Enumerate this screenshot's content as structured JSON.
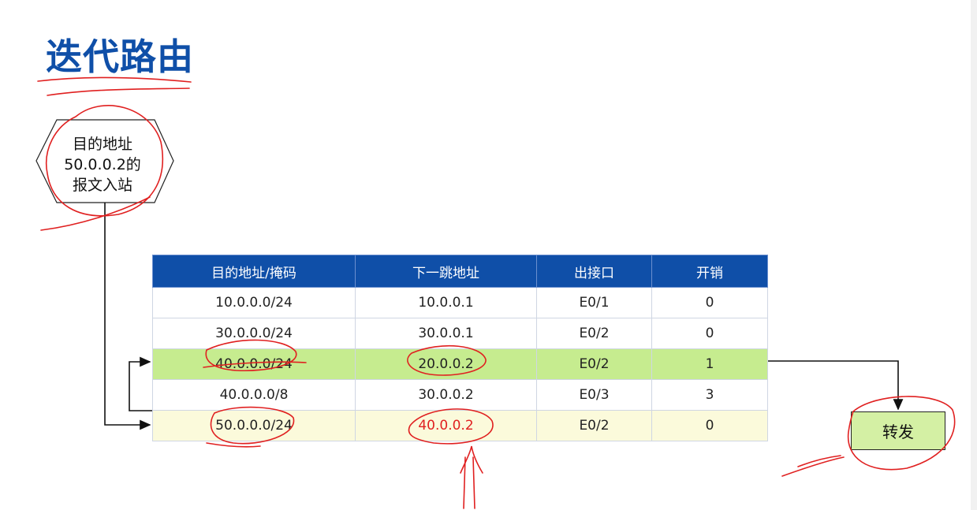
{
  "title": "迭代路由",
  "packet": {
    "lines": [
      "目的地址",
      "50.0.0.2的",
      "报文入站"
    ]
  },
  "table": {
    "headers": [
      "目的地址/掩码",
      "下一跳地址",
      "出接口",
      "开销"
    ],
    "rows": [
      [
        "10.0.0.0/24",
        "10.0.0.1",
        "E0/1",
        "0"
      ],
      [
        "30.0.0.0/24",
        "30.0.0.1",
        "E0/2",
        "0"
      ],
      [
        "40.0.0.0/24",
        "20.0.0.2",
        "E0/2",
        "1"
      ],
      [
        "40.0.0.0/8",
        "30.0.0.2",
        "E0/3",
        "3"
      ],
      [
        "50.0.0.0/24",
        "40.0.0.2",
        "E0/2",
        "0"
      ]
    ]
  },
  "forward_label": "转发",
  "colors": {
    "title": "#0f4fa8",
    "header_bg": "#0f4fa8",
    "highlight_green": "#c6ec8f",
    "highlight_yellow": "#fbfadb",
    "annotation_red": "#e02020",
    "forward_box": "#d4f0a4"
  }
}
